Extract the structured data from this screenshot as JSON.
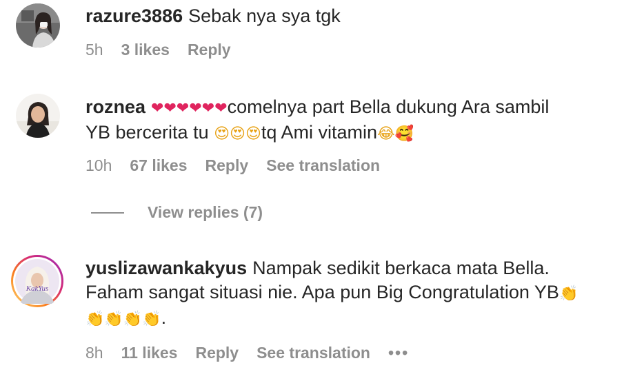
{
  "comments": [
    {
      "username": "razure3886",
      "text": "Sebak nya sya tgk",
      "time": "5h",
      "likes": "3 likes",
      "reply": "Reply"
    },
    {
      "username": "roznea",
      "hearts": "❤❤❤❤❤❤",
      "text_1": "comelnya part Bella dukung Ara sambil",
      "text_2": "YB bercerita tu",
      "faces": "😍😍😍",
      "text_3": "tq Ami vitamin",
      "end_emoji": "😂🥰",
      "time": "10h",
      "likes": "67 likes",
      "reply": "Reply",
      "translation": "See translation"
    },
    {
      "username": "yuslizawankakyus",
      "text_1": "Nampak sedikit berkaca mata Bella.",
      "text_2": "Faham sangat situasi nie. Apa pun Big Congratulation YB",
      "claps_1": "👏",
      "claps_2": "👏👏👏👏",
      "text_end": ".",
      "avatar_text": "KakYus",
      "time": "8h",
      "likes": "11 likes",
      "reply": "Reply",
      "translation": "See translation",
      "more": "•••"
    }
  ],
  "view_replies": "View replies (7)"
}
